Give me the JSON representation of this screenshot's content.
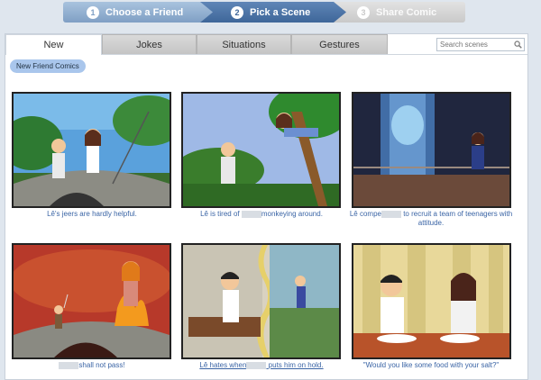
{
  "wizard": {
    "steps": [
      {
        "num": "1",
        "label": "Choose a Friend"
      },
      {
        "num": "2",
        "label": "Pick a Scene"
      },
      {
        "num": "3",
        "label": "Share Comic"
      }
    ]
  },
  "tabs": [
    "New",
    "Jokes",
    "Situations",
    "Gestures"
  ],
  "search": {
    "placeholder": "Search scenes"
  },
  "filter_pill": "New Friend Comics",
  "comics": [
    {
      "caption_a": "Lê's jeers are hardly helpful.",
      "caption_b": ""
    },
    {
      "caption_a": "Lê is tired of",
      "caption_b": "monkeying around."
    },
    {
      "caption_a": "Lê compe",
      "caption_b": "to recruit a team of teenagers with attitude."
    },
    {
      "caption_a": "",
      "caption_b": "shall not pass!"
    },
    {
      "caption_a": "Lê hates when",
      "caption_b": "puts him on hold."
    },
    {
      "caption_a": "\"Would you like some food with your salt?\"",
      "caption_b": ""
    }
  ]
}
